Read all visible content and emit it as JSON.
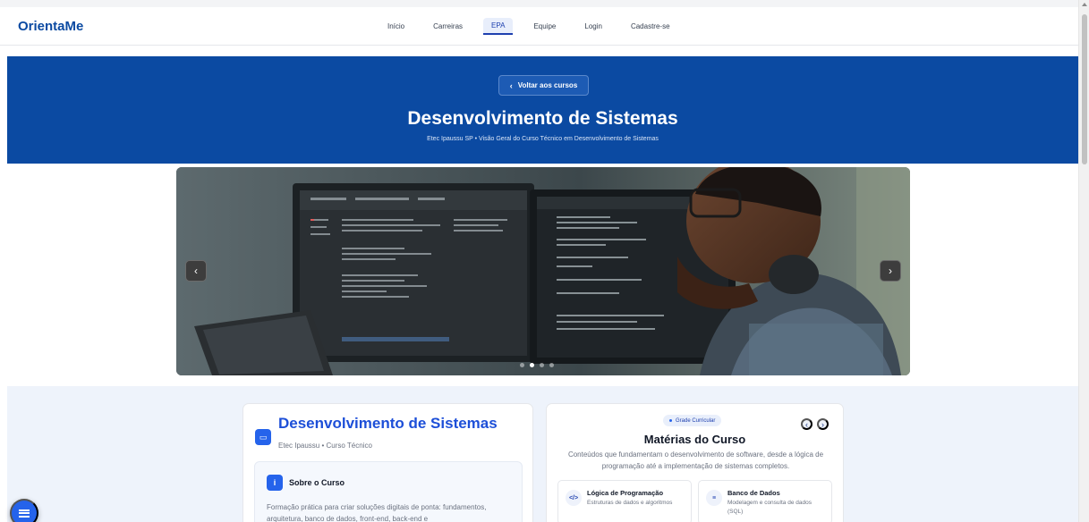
{
  "nav": {
    "brand": "OrientaMe",
    "links": [
      {
        "label": "Início",
        "active": false
      },
      {
        "label": "Carreiras",
        "active": false
      },
      {
        "label": "EPA",
        "active": true
      },
      {
        "label": "Equipe",
        "active": false
      },
      {
        "label": "Login",
        "active": false
      },
      {
        "label": "Cadastre-se",
        "active": false
      }
    ]
  },
  "hero": {
    "back_label": "Voltar aos cursos",
    "title": "Desenvolvimento de Sistemas",
    "subtitle": "Etec Ipaussu SP • Visão Geral do Curso Técnico em Desenvolvimento de Sistemas",
    "background_color": "#0b4aa2"
  },
  "carousel": {
    "prev_icon": "chevron-left-icon",
    "next_icon": "chevron-right-icon",
    "slide_count": 4,
    "active_slide": 1
  },
  "course_card": {
    "icon": "monitor-icon",
    "title": "Desenvolvimento de Sistemas",
    "subtitle": "Etec Ipaussu • Curso Técnico",
    "about": {
      "icon": "info-icon",
      "title": "Sobre o Curso",
      "text": "Formação prática para criar soluções digitais de ponta: fundamentos, arquitetura, banco de dados, front-end, back-end e"
    }
  },
  "subjects_card": {
    "badge": "Grade Curricular",
    "title": "Matérias do Curso",
    "description": "Conteúdos que fundamentam o desenvolvimento de software, desde a lógica de programação até a implementação de sistemas completos.",
    "subjects": [
      {
        "icon": "code-icon",
        "glyph": "</>",
        "title": "Lógica de Programação",
        "text": "Estruturas de dados e algoritmos"
      },
      {
        "icon": "database-icon",
        "glyph": "≡",
        "title": "Banco de Dados",
        "text": "Modelagem e consulta de dados (SQL)"
      }
    ]
  },
  "colors": {
    "accent": "#2563eb",
    "brand": "#0b4aa2"
  }
}
